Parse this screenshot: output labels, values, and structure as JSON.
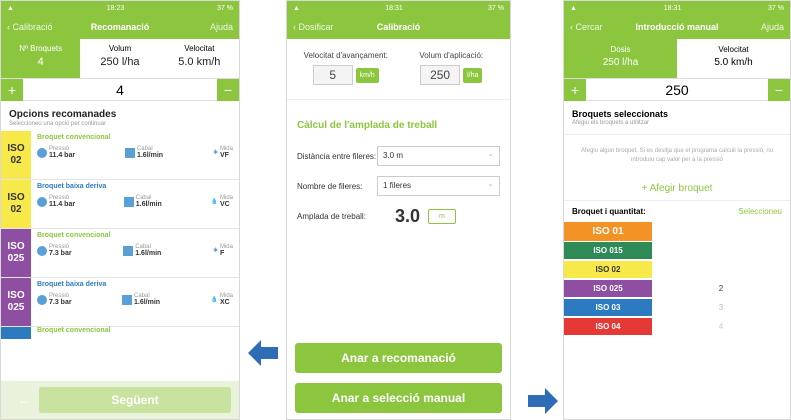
{
  "colors": {
    "accent": "#8cc63f",
    "iso01": "#f39325",
    "iso015": "#2e8b57",
    "iso02": "#f7e94a",
    "iso025": "#8e4fa3",
    "iso03": "#2c7bc0",
    "iso04": "#e53935",
    "arrow": "#2e6db5"
  },
  "status": {
    "time1": "18:23",
    "time2": "18:31",
    "time3": "18:31",
    "battery": "37 %"
  },
  "screen1": {
    "nav": {
      "back": "Calibració",
      "title": "Recomanació",
      "right": "Ajuda"
    },
    "tabs": [
      {
        "label": "Nº Broquets",
        "value": "4"
      },
      {
        "label": "Volum",
        "value": "250 l/ha"
      },
      {
        "label": "Velocitat",
        "value": "5.0 km/h"
      }
    ],
    "stepper": {
      "minus": "+",
      "value": "4",
      "plus": "−"
    },
    "title": "Opcions recomanades",
    "subtitle": "Seleccioneu una opció per continuar",
    "rows": [
      {
        "iso": "ISO 02",
        "name": "Broquet convencional",
        "p_label": "Pressió",
        "p": "11.4 bar",
        "c_label": "Cabal",
        "c": "1.6l/min",
        "m_label": "Mida",
        "m": "VF"
      },
      {
        "iso": "ISO 02",
        "name": "Broquet baixa deriva",
        "p_label": "Pressió",
        "p": "11.4 bar",
        "c_label": "Cabal",
        "c": "1.6l/min",
        "m_label": "Mida",
        "m": "VC"
      },
      {
        "iso": "ISO 025",
        "name": "Broquet convencional",
        "p_label": "Pressió",
        "p": "7.3 bar",
        "c_label": "Cabal",
        "c": "1.6l/min",
        "m_label": "Mida",
        "m": "F"
      },
      {
        "iso": "ISO 025",
        "name": "Broquet baixa deriva",
        "p_label": "Pressió",
        "p": "7.3 bar",
        "c_label": "Cabal",
        "c": "1.6l/min",
        "m_label": "Mida",
        "m": "XC"
      }
    ],
    "next_row_name": "Broquet convencional",
    "back_btn": "←",
    "next_btn": "Següent"
  },
  "screen2": {
    "nav": {
      "back": "Dosificar",
      "title": "Calibració"
    },
    "speed_label": "Velocitat d'avançament:",
    "speed_value": "5",
    "speed_unit": "km/h",
    "volume_label": "Volum d'aplicació:",
    "volume_value": "250",
    "volume_unit": "l/ha",
    "calc_title": "Càlcul de l'amplada de treball",
    "distance_label": "Distància entre fileres:",
    "distance_value": "3.0 m",
    "rows_label": "Nombre de fileres:",
    "rows_value": "1 fileres",
    "width_label": "Amplada de treball:",
    "width_value": "3.0",
    "width_unit": "m",
    "btn_recommend": "Anar a recomanació",
    "btn_manual": "Anar a selecció manual"
  },
  "screen3": {
    "nav": {
      "back": "Cercar",
      "title": "Introducció manual",
      "right": "Ajuda"
    },
    "tabs": [
      {
        "label": "Dosis",
        "value": "250 l/ha"
      },
      {
        "label": "Velocitat",
        "value": "5.0 km/h"
      }
    ],
    "stepper": {
      "minus": "+",
      "value": "250",
      "plus": "−"
    },
    "title": "Broquets seleccionats",
    "subtitle": "Afegiu els broquets a utilitzar",
    "info": "Afegiu algun broquet. Si es desitja que el programa calculi la pressió, no introduiu cap valor per a la pressió",
    "add": "+ Afegir broquet",
    "qty_label": "Broquet i quantitat:",
    "qty_action": "Seleccioneu",
    "nozzles": [
      {
        "name": "ISO 01",
        "qty": ""
      },
      {
        "name": "ISO 015",
        "qty": ""
      },
      {
        "name": "ISO 02",
        "qty": ""
      },
      {
        "name": "ISO 025",
        "qty": "2"
      },
      {
        "name": "ISO 03",
        "qty": "3"
      },
      {
        "name": "ISO 04",
        "qty": "4"
      }
    ]
  }
}
